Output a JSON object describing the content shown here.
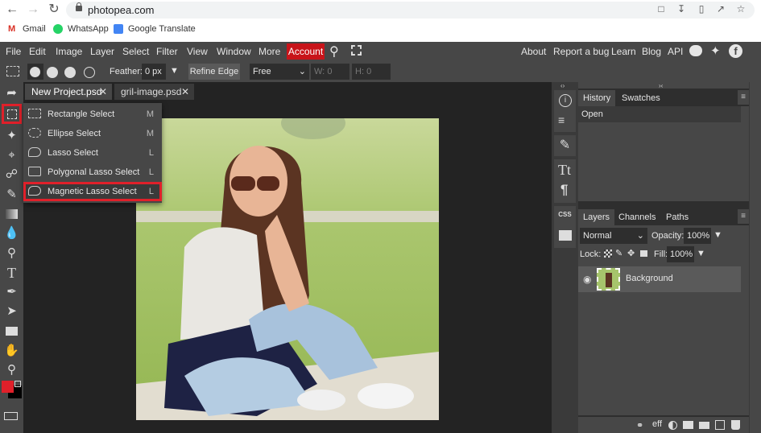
{
  "browser": {
    "url": "photopea.com",
    "bookmarks": [
      {
        "label": "Gmail",
        "icon": "gmail-icon",
        "color": "#d93025"
      },
      {
        "label": "WhatsApp",
        "icon": "whatsapp-icon",
        "color": "#25d366"
      },
      {
        "label": "Google Translate",
        "icon": "google-translate-icon",
        "color": "#4285f4"
      }
    ]
  },
  "menubar": {
    "items": [
      "File",
      "Edit",
      "Image",
      "Layer",
      "Select",
      "Filter",
      "View",
      "Window",
      "More"
    ],
    "account": "Account",
    "right_links": [
      "About",
      "Report a bug",
      "Learn",
      "Blog",
      "API"
    ]
  },
  "options": {
    "feather_label": "Feather:",
    "feather_value": "0 px",
    "refine_edge": "Refine Edge",
    "style_value": "Free",
    "w_label": "W:",
    "w_value": "0",
    "h_label": "H:",
    "h_value": "0"
  },
  "tabs": [
    {
      "label": "New Project.psd",
      "active": true
    },
    {
      "label": "gril-image.psd",
      "active": false
    }
  ],
  "flyout": {
    "items": [
      {
        "label": "Rectangle Select",
        "shortcut": "M"
      },
      {
        "label": "Ellipse Select",
        "shortcut": "M"
      },
      {
        "label": "Lasso Select",
        "shortcut": "L"
      },
      {
        "label": "Polygonal Lasso Select",
        "shortcut": "L"
      },
      {
        "label": "Magnetic Lasso Select",
        "shortcut": "L",
        "highlighted": true
      }
    ]
  },
  "colors": {
    "foreground": "#e0202a",
    "background": "#000000",
    "accent": "#c8141a"
  },
  "history_panel": {
    "tabs": [
      "History",
      "Swatches"
    ],
    "entries": [
      "Open"
    ]
  },
  "layers_panel": {
    "tabs": [
      "Layers",
      "Channels",
      "Paths"
    ],
    "blend_mode": "Normal",
    "opacity_label": "Opacity:",
    "opacity": "100%",
    "lock_label": "Lock:",
    "fill_label": "Fill:",
    "fill": "100%",
    "layers": [
      {
        "name": "Background",
        "visible": true
      }
    ]
  },
  "iconcol": {
    "css_label": "CSS"
  }
}
